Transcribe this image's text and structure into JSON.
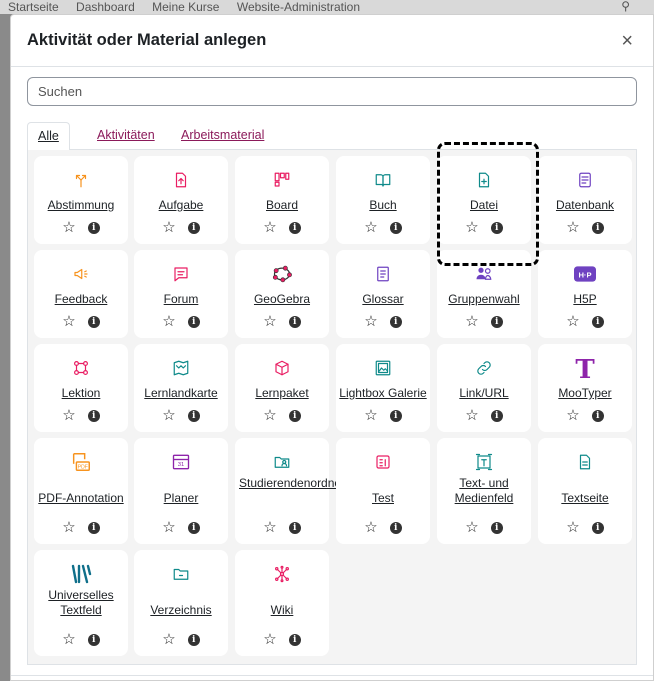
{
  "background_nav": {
    "items": [
      "Startseite",
      "Dashboard",
      "Meine Kurse",
      "Website-Administration"
    ]
  },
  "modal": {
    "title": "Aktivität oder Material anlegen",
    "close_label": "×",
    "search_placeholder": "Suchen"
  },
  "tabs": [
    {
      "label": "Alle",
      "active": true
    },
    {
      "label": "Aktivitäten",
      "active": false
    },
    {
      "label": "Arbeitsmaterial",
      "active": false
    }
  ],
  "actions": {
    "star": "☆",
    "info": "i"
  },
  "tiles": [
    {
      "name": "Abstimmung",
      "icon": "poll-icon",
      "color": "#f7931e"
    },
    {
      "name": "Aufgabe",
      "icon": "assignment-icon",
      "color": "#e91e63"
    },
    {
      "name": "Board",
      "icon": "board-icon",
      "color": "#e91e63"
    },
    {
      "name": "Buch",
      "icon": "book-icon",
      "color": "#0f8a8a"
    },
    {
      "name": "Datei",
      "icon": "file-icon",
      "color": "#0f8a8a"
    },
    {
      "name": "Datenbank",
      "icon": "database-icon",
      "color": "#6f42c1"
    },
    {
      "name": "Feedback",
      "icon": "feedback-icon",
      "color": "#f7931e"
    },
    {
      "name": "Forum",
      "icon": "forum-icon",
      "color": "#e91e63"
    },
    {
      "name": "GeoGebra",
      "icon": "geogebra-icon",
      "color": "#e91e63"
    },
    {
      "name": "Glossar",
      "icon": "glossary-icon",
      "color": "#6f42c1"
    },
    {
      "name": "Gruppenwahl",
      "icon": "group-choice-icon",
      "color": "#6f42c1"
    },
    {
      "name": "H5P",
      "icon": "h5p-icon",
      "color": "#6f42c1"
    },
    {
      "name": "Lektion",
      "icon": "lesson-icon",
      "color": "#e91e63"
    },
    {
      "name": "Lernlandkarte",
      "icon": "learning-map-icon",
      "color": "#0f8a8a"
    },
    {
      "name": "Lernpaket",
      "icon": "learning-package-icon",
      "color": "#e91e63"
    },
    {
      "name": "Lightbox Galerie",
      "icon": "lightbox-gallery-icon",
      "color": "#0f8a8a"
    },
    {
      "name": "Link/URL",
      "icon": "link-icon",
      "color": "#0f8a8a"
    },
    {
      "name": "MooTyper",
      "icon": "mootyper-icon",
      "color": "#8e24aa"
    },
    {
      "name": "PDF-Annotation",
      "icon": "pdf-annotation-icon",
      "color": "#f7931e"
    },
    {
      "name": "Planer",
      "icon": "planner-icon",
      "color": "#8e24aa"
    },
    {
      "name": "Studierendenordner",
      "icon": "student-folder-icon",
      "color": "#0f8a8a"
    },
    {
      "name": "Test",
      "icon": "quiz-icon",
      "color": "#e91e63"
    },
    {
      "name": "Text- und Medienfeld",
      "icon": "text-media-icon",
      "color": "#0f8a8a"
    },
    {
      "name": "Textseite",
      "icon": "page-icon",
      "color": "#0f8a8a"
    },
    {
      "name": "Universelles Textfeld",
      "icon": "universal-textfield-icon",
      "color": "#0f6f8a"
    },
    {
      "name": "Verzeichnis",
      "icon": "folder-icon",
      "color": "#0f8a8a"
    },
    {
      "name": "Wiki",
      "icon": "wiki-icon",
      "color": "#e91e63"
    }
  ]
}
